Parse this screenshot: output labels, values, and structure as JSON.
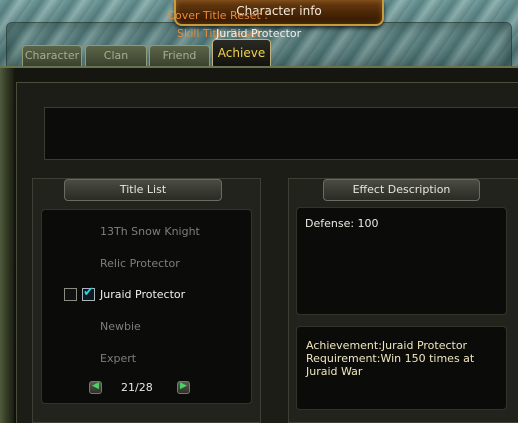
{
  "window": {
    "title": "Character info"
  },
  "tabs": [
    {
      "label": "Character",
      "active": false
    },
    {
      "label": "Clan",
      "active": false
    },
    {
      "label": "Friend",
      "active": false
    },
    {
      "label": "Achieve",
      "active": true
    }
  ],
  "reset": {
    "cover_label": "Cover Title Reset :",
    "cover_value": "",
    "skill_label": "Skill Title Reset :",
    "skill_value": "Juraid Protector"
  },
  "title_list": {
    "header": "Title List",
    "items": [
      {
        "name": "13Th Snow Knight",
        "selected": false
      },
      {
        "name": "Relic Protector",
        "selected": false
      },
      {
        "name": "Juraid Protector",
        "selected": true,
        "cover_checked": false,
        "skill_checked": true
      },
      {
        "name": "Newbie",
        "selected": false
      },
      {
        "name": "Expert",
        "selected": false
      }
    ],
    "page": "21/28"
  },
  "effect": {
    "header": "Effect Description",
    "stat_text": "Defense: 100",
    "achievement_text": "Achievement:Juraid Protector\n Requirement:Win 150 times at\nJuraid War"
  },
  "colors": {
    "label_orange": "#e8893a",
    "active_tab_yellow": "#f4d34a",
    "checkmark_cyan": "#2fd1e6",
    "arrow_green": "#4bd466"
  },
  "icons": [
    "checkmark-icon",
    "arrow-left-icon",
    "arrow-right-icon"
  ]
}
